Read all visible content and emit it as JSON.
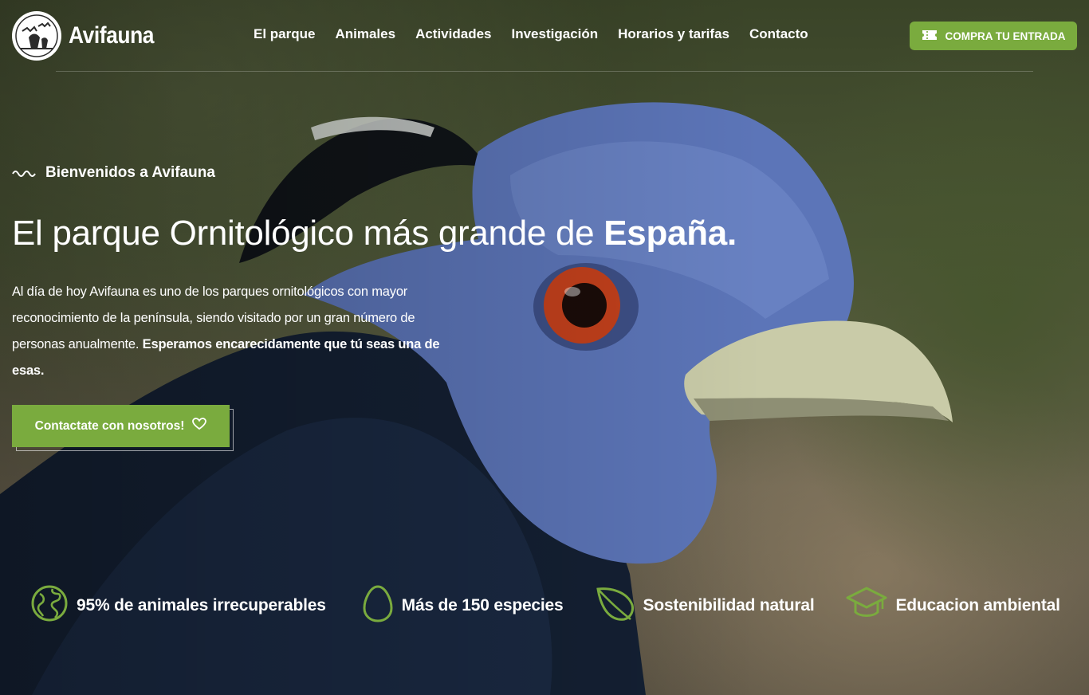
{
  "header": {
    "brand": "Avifauna",
    "nav": [
      {
        "label": "El parque"
      },
      {
        "label": "Animales"
      },
      {
        "label": "Actividades"
      },
      {
        "label": "Investigación"
      },
      {
        "label": "Horarios y tarifas"
      },
      {
        "label": "Contacto"
      }
    ],
    "cta_label": "COMPRA TU ENTRADA"
  },
  "hero": {
    "eyebrow": "Bienvenidos a Avifauna",
    "headline_regular": "El parque Ornitológico más grande de ",
    "headline_bold": "España.",
    "intro_regular": "Al día de hoy Avifauna es uno de los parques ornitológicos con mayor reconocimiento de la península, siendo visitado por un gran número de personas anualmente. ",
    "intro_bold": "Esperamos encarecidamente que tú seas una de esas.",
    "button_label": "Contactate con nosotros!"
  },
  "features": [
    {
      "icon": "globe-icon",
      "label": "95% de animales irrecuperables"
    },
    {
      "icon": "egg-icon",
      "label": "Más de 150 especies"
    },
    {
      "icon": "leaf-icon",
      "label": "Sostenibilidad natural"
    },
    {
      "icon": "graduation-cap-icon",
      "label": "Educacion ambiental"
    }
  ],
  "colors": {
    "accent": "#7aab3e",
    "text": "#ffffff"
  }
}
